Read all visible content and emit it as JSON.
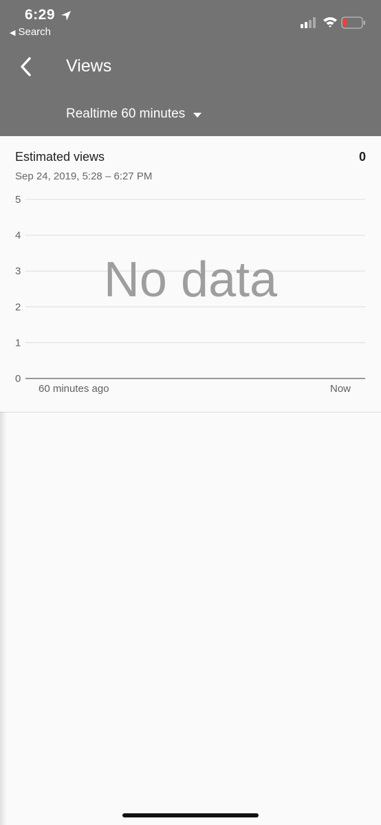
{
  "status_bar": {
    "time": "6:29",
    "back_label": "Search"
  },
  "header": {
    "title": "Views",
    "period_label": "Realtime 60 minutes"
  },
  "card": {
    "metric_title": "Estimated views",
    "metric_value": "0",
    "date_range": "Sep 24, 2019, 5:28 – 6:27 PM"
  },
  "chart_data": {
    "type": "line",
    "y_ticks": [
      "5",
      "4",
      "3",
      "2",
      "1",
      "0"
    ],
    "x_labels": [
      "60 minutes ago",
      "Now"
    ],
    "ylim": [
      0,
      5
    ],
    "grid": true,
    "empty_message": "No data",
    "series": []
  },
  "colors": {
    "header_bg": "#737373",
    "page_bg": "#fafafa",
    "gridline": "#dddddd",
    "no_data_text": "#9e9e9e",
    "battery_low": "#ff3b30"
  },
  "icons": {
    "back": "chevron-left-icon",
    "dropdown": "caret-down-icon",
    "location": "location-arrow-icon",
    "signal": "cellular-signal-icon",
    "wifi": "wifi-icon",
    "battery": "battery-low-icon"
  }
}
